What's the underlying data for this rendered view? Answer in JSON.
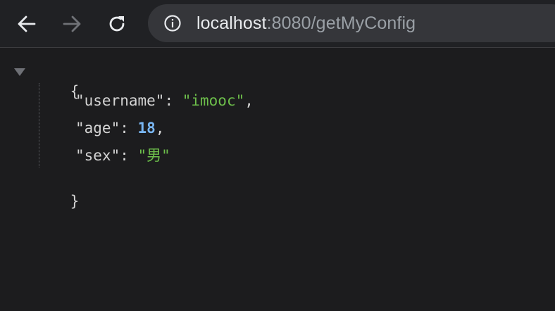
{
  "browser": {
    "url_host": "localhost",
    "url_rest": ":8080/getMyConfig",
    "icons": {
      "back": "arrow-left-icon",
      "forward": "arrow-right-icon",
      "reload": "reload-icon",
      "site_info": "info-circle-icon"
    }
  },
  "json": {
    "open_brace": "{",
    "close_brace": "}",
    "entries": [
      {
        "key": "\"username\"",
        "value": "\"imooc\"",
        "value_type": "string",
        "trailing": ","
      },
      {
        "key": "\"age\"",
        "value": "18",
        "value_type": "number",
        "trailing": ","
      },
      {
        "key": "\"sex\"",
        "value": "\"男\"",
        "value_type": "string",
        "trailing": ""
      }
    ],
    "colon": ": "
  },
  "colors": {
    "background": "#1c1c1e",
    "toolbar": "#202124",
    "string": "#6dbf4b",
    "number": "#79b6f2",
    "text": "#d4d4d4"
  }
}
